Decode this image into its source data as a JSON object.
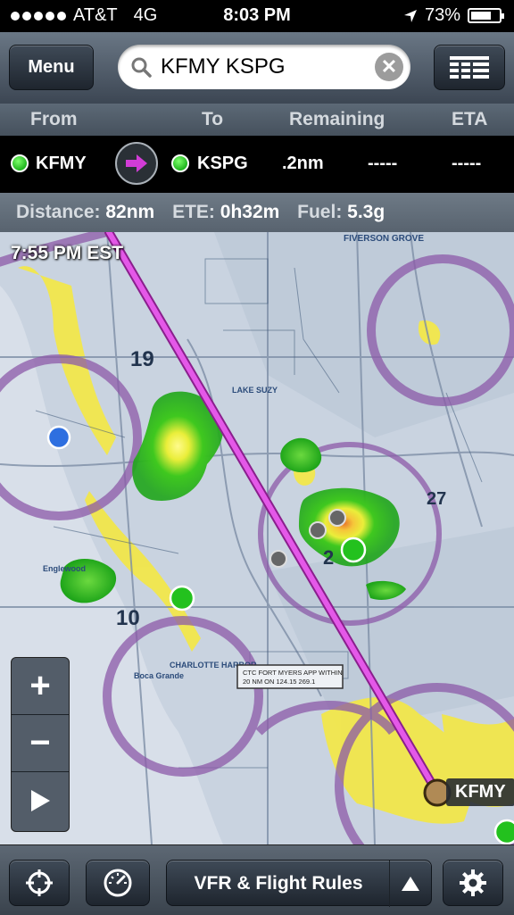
{
  "status_bar": {
    "carrier": "AT&T",
    "network": "4G",
    "time": "8:03 PM",
    "battery": "73%",
    "battery_level": 0.73,
    "location_icon": "location-arrow-icon"
  },
  "nav": {
    "menu_label": "Menu",
    "search_value": "KFMY KSPG",
    "search_icon": "search-icon",
    "clear_icon": "clear-icon",
    "list_icon": "list-icon"
  },
  "route_header": {
    "from": "From",
    "to": "To",
    "remaining": "Remaining",
    "eta": "ETA"
  },
  "route": {
    "from_value": "KFMY",
    "to_value": "KSPG",
    "remaining_value": ".2nm",
    "eta_value": "-----",
    "extra_value": "-----"
  },
  "summary": {
    "distance_label": "Distance:",
    "distance_value": "82nm",
    "ete_label": "ETE:",
    "ete_value": "0h32m",
    "fuel_label": "Fuel:",
    "fuel_value": "5.3g"
  },
  "map": {
    "timestamp": "7:55 PM EST",
    "airport_label": "KFMY",
    "zoom_in": "+",
    "zoom_out": "−",
    "play_icon": "play-icon"
  },
  "toolbar": {
    "locate_icon": "crosshair-icon",
    "gauge_icon": "gauge-icon",
    "layer_label": "VFR & Flight Rules",
    "up_icon": "triangle-up-icon",
    "settings_icon": "gear-icon"
  },
  "colors": {
    "route_line": "#d23cd6",
    "weather_green": "#2fc41a",
    "weather_yellow": "#f2e94a",
    "airspace_purple": "#8c5aa8"
  }
}
